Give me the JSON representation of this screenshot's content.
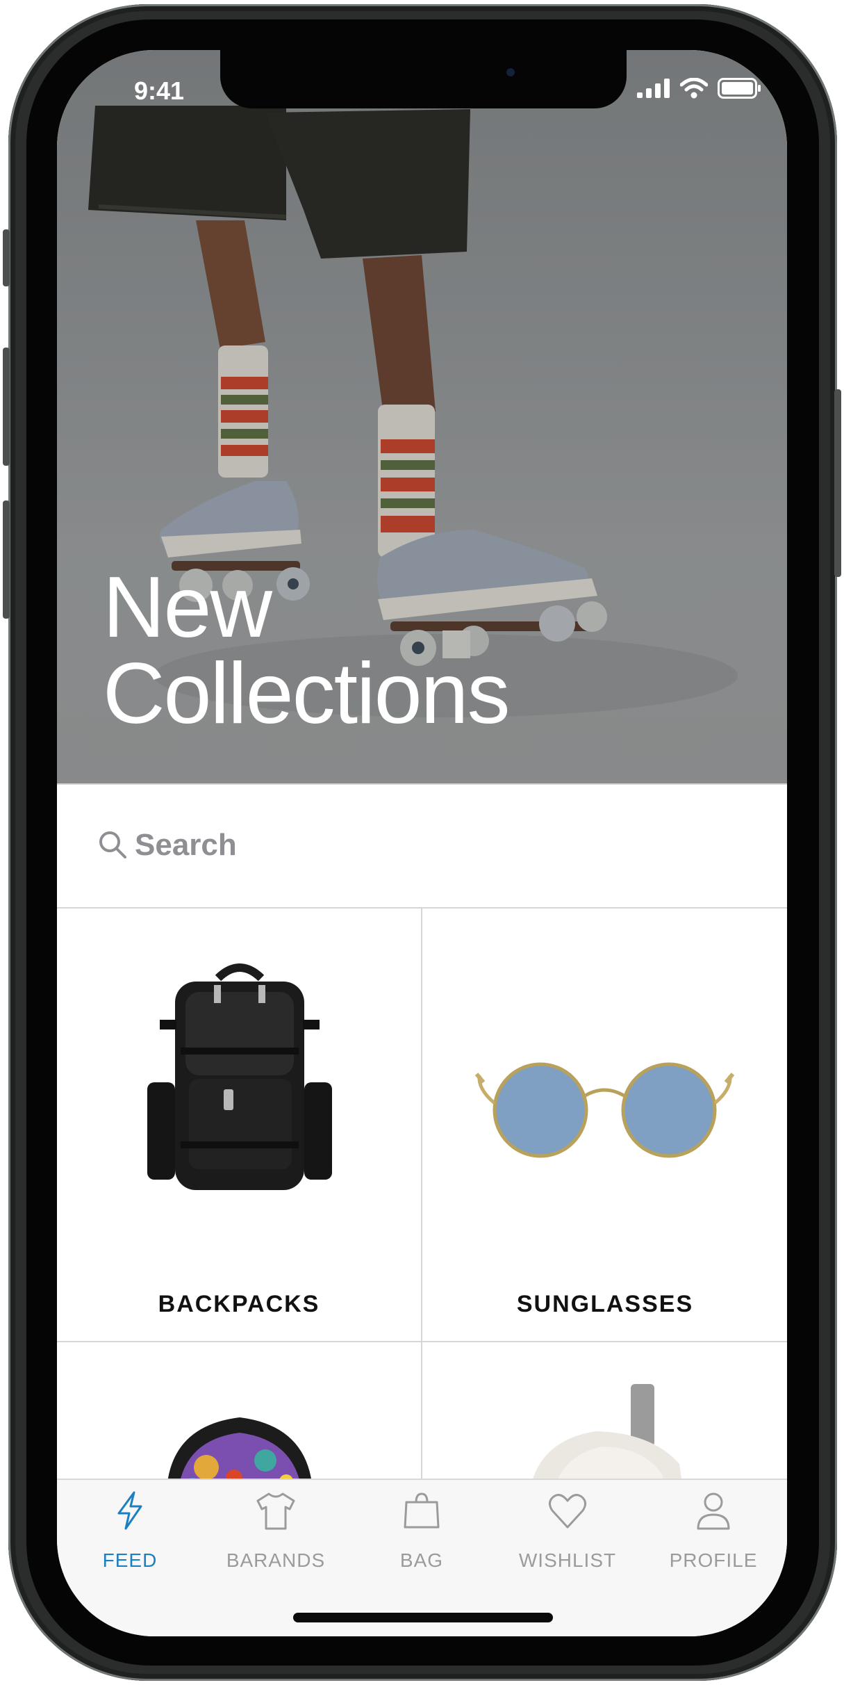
{
  "status_bar": {
    "time": "9:41"
  },
  "hero": {
    "title": "New\nCollections"
  },
  "search": {
    "placeholder": "Search"
  },
  "categories": [
    {
      "label": "BACKPACKS"
    },
    {
      "label": "SUNGLASSES"
    },
    {
      "label": ""
    },
    {
      "label": ""
    }
  ],
  "tabbar": {
    "tabs": [
      {
        "label": "FEED",
        "icon": "lightning-icon",
        "active": true
      },
      {
        "label": "BARANDS",
        "icon": "tshirt-icon",
        "active": false
      },
      {
        "label": "BAG",
        "icon": "shopping-bag-icon",
        "active": false
      },
      {
        "label": "WISHLIST",
        "icon": "heart-icon",
        "active": false
      },
      {
        "label": "PROFILE",
        "icon": "person-icon",
        "active": false
      }
    ]
  },
  "colors": {
    "accent": "#1b7fc4",
    "inactive": "#9b9b9b"
  }
}
